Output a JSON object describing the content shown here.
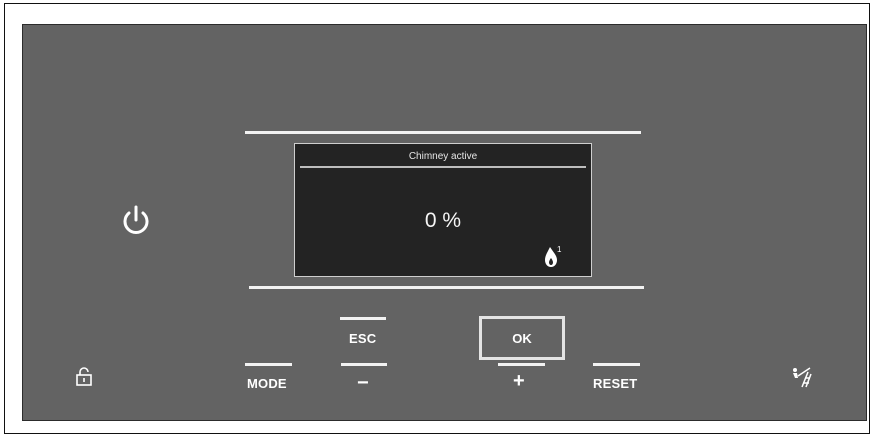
{
  "screen": {
    "title": "Chimney active",
    "value": "0 %",
    "flame_superscript": "1"
  },
  "buttons": {
    "esc": "ESC",
    "ok": "OK",
    "mode": "MODE",
    "minus": "−",
    "plus": "+",
    "reset": "RESET"
  },
  "icons": {
    "power": "power-icon",
    "lock": "lock-icon",
    "chimney_sweep": "chimney-sweep-icon",
    "flame": "flame-icon"
  },
  "colors": {
    "panel": "#636363",
    "screen": "#232323",
    "text": "#ffffff"
  }
}
